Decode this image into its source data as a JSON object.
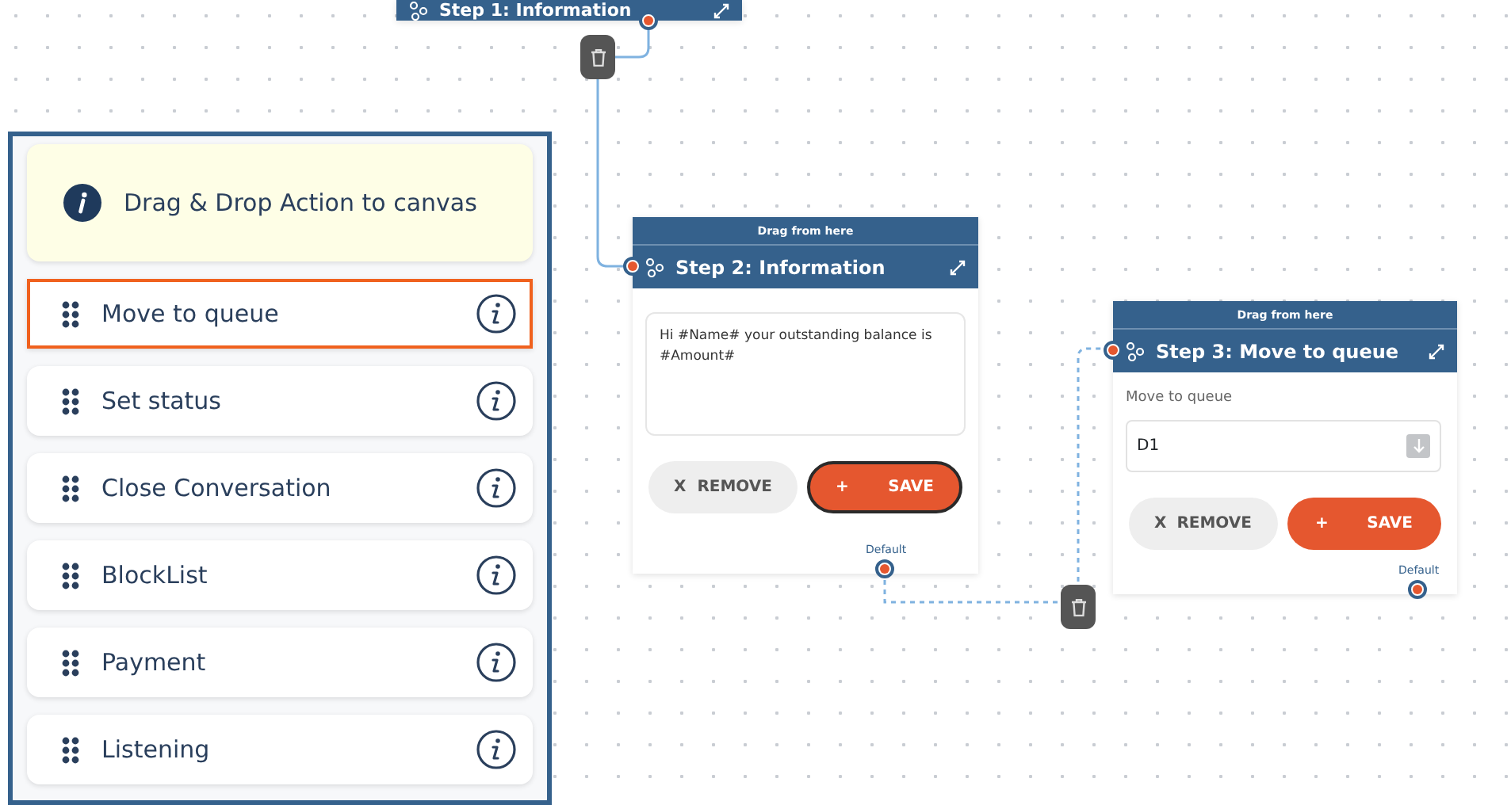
{
  "sidebar": {
    "info": "Drag & Drop Action to canvas",
    "items": [
      {
        "label": "Move to queue",
        "selected": true
      },
      {
        "label": "Set status",
        "selected": false
      },
      {
        "label": "Close Conversation",
        "selected": false
      },
      {
        "label": "BlockList",
        "selected": false
      },
      {
        "label": "Payment",
        "selected": false
      },
      {
        "label": "Listening",
        "selected": false
      }
    ]
  },
  "nodes": [
    {
      "kind": "collapsed",
      "title": "Step 1: Information"
    },
    {
      "kind": "message",
      "drag_label": "Drag from here",
      "title": "Step 2: Information",
      "message": "Hi #Name# your outstanding balance is #Amount#",
      "remove_icon": "X",
      "remove_label": "REMOVE",
      "save_icon": "+",
      "save_label": "SAVE",
      "save_focused": true,
      "port_label": "Default"
    },
    {
      "kind": "queue",
      "drag_label": "Drag from here",
      "title": "Step 3: Move to queue",
      "field_label": "Move to queue",
      "field_value": "D1",
      "remove_icon": "X",
      "remove_label": "REMOVE",
      "save_icon": "+",
      "save_label": "SAVE",
      "save_focused": false,
      "port_label": "Default"
    }
  ]
}
